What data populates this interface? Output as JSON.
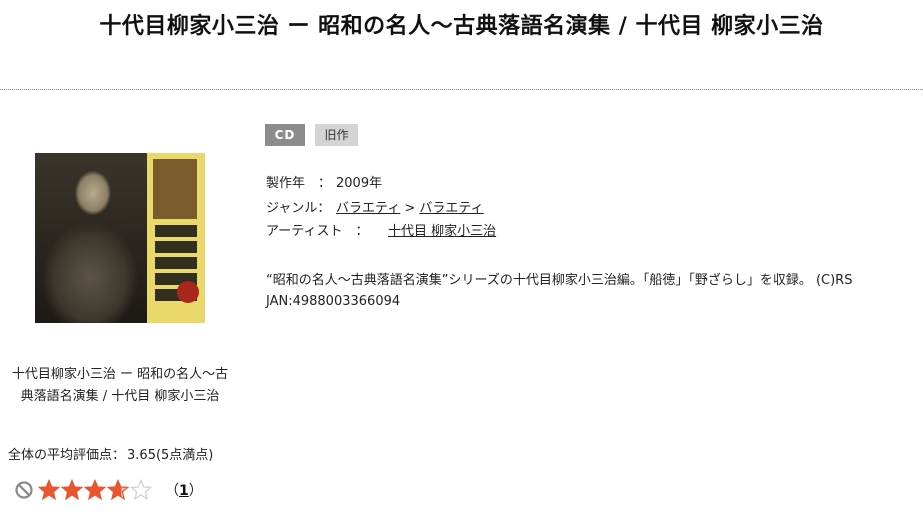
{
  "page": {
    "title": "十代目柳家小三治 ー 昭和の名人～古典落語名演集 / 十代目 柳家小三治"
  },
  "cover": {
    "icon": "album-cover"
  },
  "caption": {
    "line1": "十代目柳家小三治 ー 昭和の名人～古",
    "line2": "典落語名演集 / 十代目 柳家小三治"
  },
  "rating": {
    "summary_label": "全体の平均評価点：",
    "summary_value": "3.65(5点満点)",
    "average": 3.65,
    "max": 5,
    "review_open": "（",
    "review_count": "1",
    "review_close": "）",
    "colors": {
      "star_filled": "#e8552e",
      "star_empty": "#cfcfcf",
      "no_icon": "#8a8a8a"
    }
  },
  "tags": {
    "format": "CD",
    "status": "旧作"
  },
  "details": {
    "year_label": "製作年　：",
    "year_value": "2009年",
    "genre_label": "ジャンル：",
    "genre_1": "バラエティ",
    "genre_sep": ">",
    "genre_2": "バラエティ",
    "artist_label": "アーティスト　：",
    "artist_value": "十代目 柳家小三治"
  },
  "description": {
    "text": "“昭和の名人～古典落語名演集”シリーズの十代目柳家小三治編。「船徳」「野ざらし」を収録。 (C)RS",
    "jan": "JAN:4988003366094"
  }
}
